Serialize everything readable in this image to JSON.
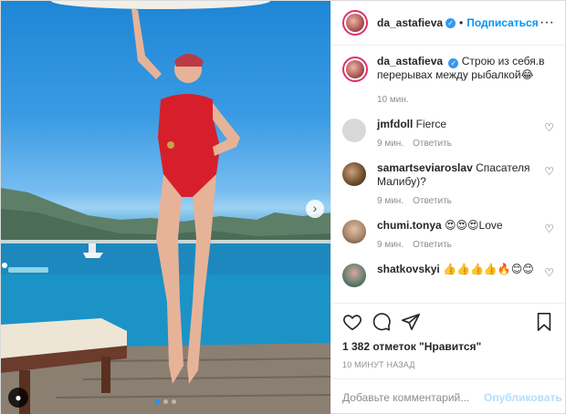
{
  "post": {
    "author": "da_astafieva",
    "follow_label": "Подписаться",
    "separator": "•",
    "carousel_dots": 3,
    "active_dot": 0
  },
  "caption": {
    "username": "da_astafieva",
    "text": "Строю из себя.в перерывах между рыбалкой😂",
    "time": "10 мин."
  },
  "comments": [
    {
      "username": "jmfdoll",
      "text": "Fierce",
      "time": "9 мин.",
      "reply": "Ответить",
      "avatar_color": "#d8d8d8"
    },
    {
      "username": "samartseviaroslav",
      "text": "Спасателя Малибу)?",
      "time": "9 мин.",
      "reply": "Ответить",
      "avatar_color": "#6b4b2b"
    },
    {
      "username": "chumi.tonya",
      "text": "😍😍😍Love",
      "time": "9 мин.",
      "reply": "Ответить",
      "avatar_color": "#a8876d"
    },
    {
      "username": "shatkovskyi",
      "text": "👍👍👍👍🔥😊😊",
      "time": "",
      "reply": "",
      "avatar_color": "#5f7d6c"
    }
  ],
  "likes": "1 382 отметок \"Нравится\"",
  "timestamp": "10 МИНУТ НАЗАД",
  "add_comment": {
    "placeholder": "Добавьте комментарий...",
    "post_label": "Опубликовать"
  },
  "icons": {
    "like": "heart-icon",
    "comment": "comment-icon",
    "share": "share-icon",
    "save": "bookmark-icon",
    "more": "more-icon"
  },
  "colors": {
    "link": "#0095f6",
    "muted": "#8e8e8e",
    "border": "#efefef",
    "active_dot": "#1e90ff"
  }
}
